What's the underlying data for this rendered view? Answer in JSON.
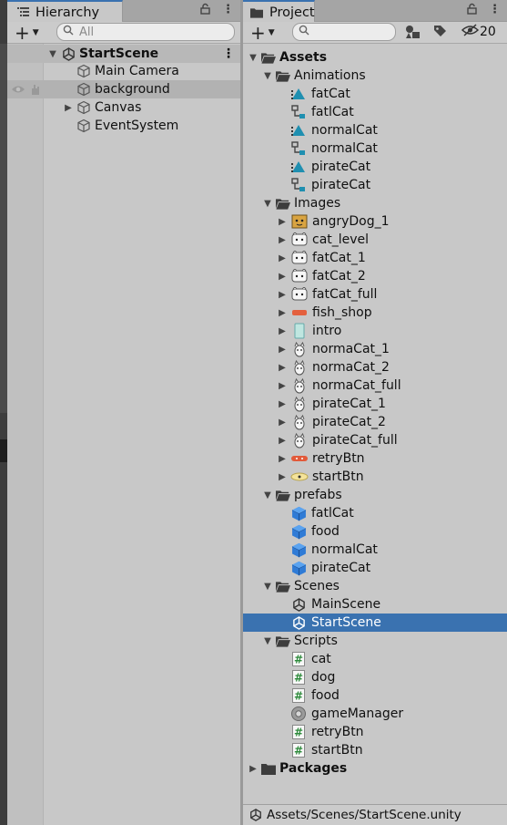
{
  "hierarchy": {
    "tab_title": "Hierarchy",
    "search_placeholder": "All",
    "scene_name": "StartScene",
    "items": [
      {
        "label": "Main Camera"
      },
      {
        "label": "background"
      },
      {
        "label": "Canvas"
      },
      {
        "label": "EventSystem"
      }
    ]
  },
  "project": {
    "tab_title": "Project",
    "hidden_count": "20",
    "assets_label": "Assets",
    "animations": {
      "label": "Animations",
      "items": [
        {
          "label": "fatCat",
          "icon": "animation-clip-icon"
        },
        {
          "label": "fatlCat",
          "icon": "animator-controller-icon"
        },
        {
          "label": "normalCat",
          "icon": "animation-clip-icon"
        },
        {
          "label": "normalCat",
          "icon": "animator-controller-icon"
        },
        {
          "label": "pirateCat",
          "icon": "animation-clip-icon"
        },
        {
          "label": "pirateCat",
          "icon": "animator-controller-icon"
        }
      ]
    },
    "images": {
      "label": "Images",
      "items": [
        {
          "label": "angryDog_1"
        },
        {
          "label": "cat_level"
        },
        {
          "label": "fatCat_1"
        },
        {
          "label": "fatCat_2"
        },
        {
          "label": "fatCat_full"
        },
        {
          "label": "fish_shop"
        },
        {
          "label": "intro"
        },
        {
          "label": "normaCat_1"
        },
        {
          "label": "normaCat_2"
        },
        {
          "label": "normaCat_full"
        },
        {
          "label": "pirateCat_1"
        },
        {
          "label": "pirateCat_2"
        },
        {
          "label": "pirateCat_full"
        },
        {
          "label": "retryBtn"
        },
        {
          "label": "startBtn"
        }
      ]
    },
    "prefabs": {
      "label": "prefabs",
      "items": [
        {
          "label": "fatlCat"
        },
        {
          "label": "food"
        },
        {
          "label": "normalCat"
        },
        {
          "label": "pirateCat"
        }
      ]
    },
    "scenes": {
      "label": "Scenes",
      "items": [
        {
          "label": "MainScene"
        },
        {
          "label": "StartScene"
        }
      ]
    },
    "scripts": {
      "label": "Scripts",
      "items": [
        {
          "label": "cat"
        },
        {
          "label": "dog"
        },
        {
          "label": "food"
        },
        {
          "label": "gameManager"
        },
        {
          "label": "retryBtn"
        },
        {
          "label": "startBtn"
        }
      ]
    },
    "packages_label": "Packages",
    "status_path": "Assets/Scenes/StartScene.unity"
  },
  "colors": {
    "selection": "#3a72b0",
    "panel_bg": "#c8c8c8",
    "prefab_blue": "#2f7bd6",
    "script_green": "#2c8a3a"
  }
}
